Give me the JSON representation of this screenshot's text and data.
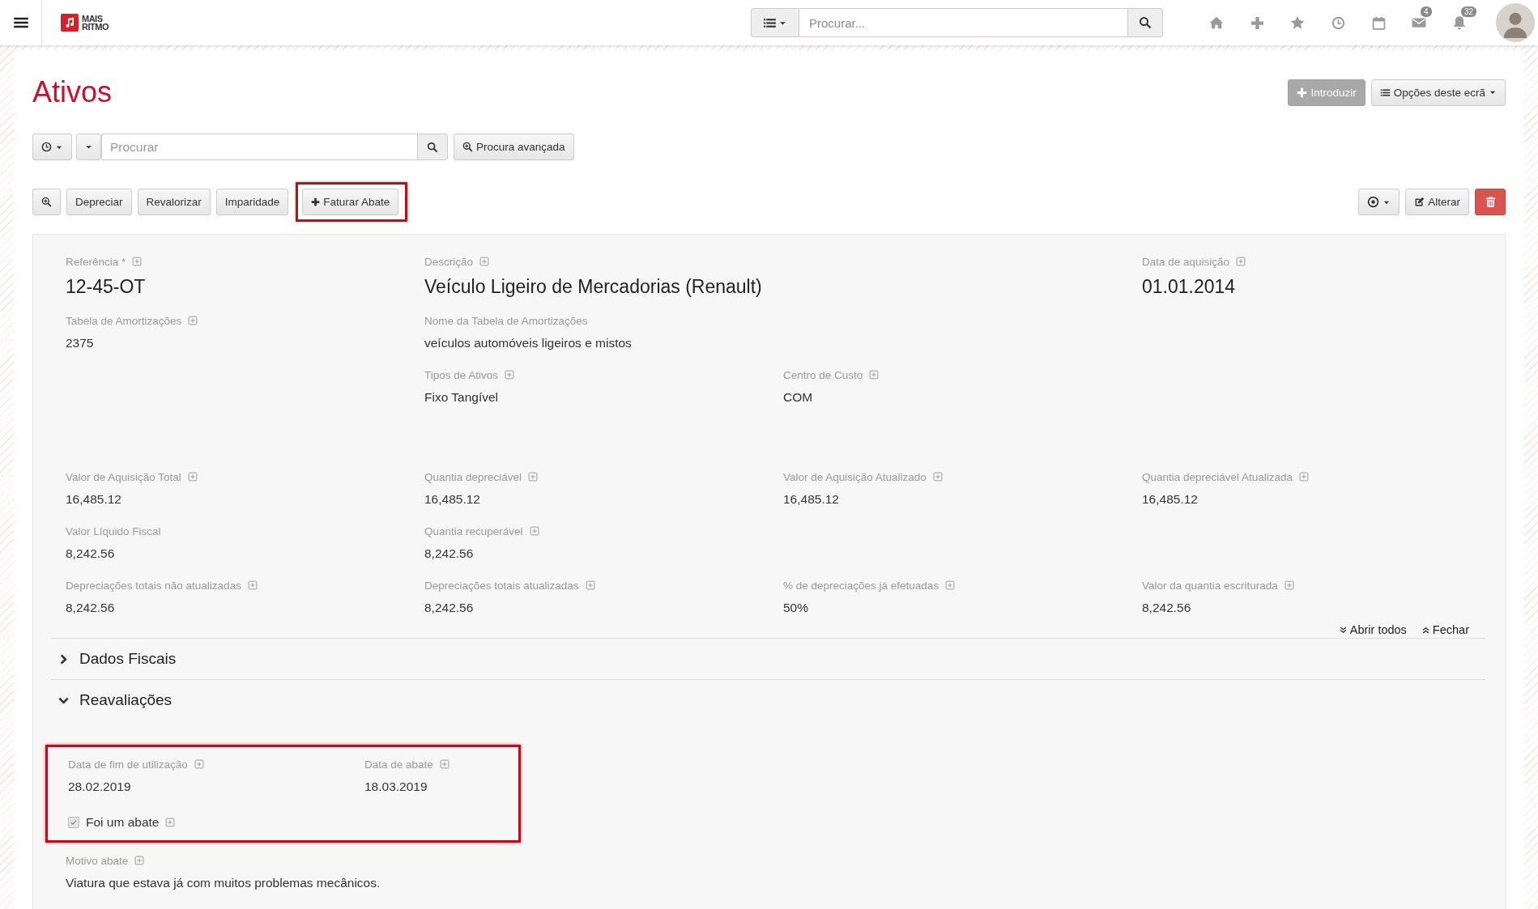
{
  "topbar": {
    "logo": [
      "MAIS",
      "RITMO"
    ],
    "search": {
      "placeholder": "Procurar..."
    },
    "message_count": "4",
    "notification_count": "32"
  },
  "title": "Ativos",
  "header_buttons": [
    {
      "label": "Introduzir",
      "kind": "primary"
    },
    {
      "label": "Opções deste ecrã",
      "kind": "menu"
    }
  ],
  "search": {
    "placeholder": "Procurar",
    "advanced": "Procura avançada"
  },
  "actions": [
    {
      "label": "Depreciar",
      "highlighted": false
    },
    {
      "label": "Revalorizar",
      "highlighted": false
    },
    {
      "label": "Imparidade",
      "highlighted": false
    },
    {
      "label": "Faturar Abate",
      "highlighted": true
    }
  ],
  "edit_button": "Alterar",
  "groups": [
    {
      "rows": [
        {
          "large": true,
          "cells": [
            {
              "label": "Referência *",
              "value": "12-45-OT",
              "info": true
            },
            {
              "label": "Descrição",
              "value": "Veículo Ligeiro de Mercadorias (Renault)",
              "info": true
            },
            null,
            {
              "label": "Data de aquisição",
              "value": "01.01.2014",
              "info": true
            }
          ]
        },
        {
          "large": false,
          "cells": [
            {
              "label": "Tabela de Amortizações",
              "value": "2375",
              "info": true
            },
            {
              "label": "Nome da Tabela de Amortizações",
              "value": "veículos automóveis ligeiros e mistos",
              "info": false
            }
          ]
        },
        {
          "large": false,
          "cells": [
            null,
            {
              "label": "Tipos de Ativos",
              "value": "Fixo Tangível",
              "info": true
            },
            {
              "label": "Centro de Custo",
              "value": "COM",
              "info": true
            }
          ]
        }
      ]
    },
    {
      "rows": [
        {
          "large": false,
          "cells": [
            {
              "label": "Valor de Aquisição Total",
              "value": "16,485.12",
              "info": true
            },
            {
              "label": "Quantia depreciável",
              "value": "16,485.12",
              "info": true
            },
            {
              "label": "Valor de Aquisição Atualizado",
              "value": "16,485.12",
              "info": true
            },
            {
              "label": "Quantia depreciável Atualizada",
              "value": "16,485.12",
              "info": true
            }
          ]
        },
        {
          "large": false,
          "cells": [
            {
              "label": "Valor Líquido Fiscal",
              "value": "8,242.56",
              "info": false
            },
            {
              "label": "Quantia recuperável",
              "value": "8,242.56",
              "info": true
            }
          ]
        },
        {
          "large": false,
          "cells": [
            {
              "label": "Depreciações totais não atualizadas",
              "value": "8,242.56",
              "info": true
            },
            {
              "label": "Depreciações totais atualizadas",
              "value": "8,242.56",
              "info": true
            },
            {
              "label": "% de depreciações já efetuadas",
              "value": "50%",
              "info": true
            },
            {
              "label": "Valor da quantia escriturada",
              "value": "8,242.56",
              "info": true
            }
          ]
        }
      ]
    }
  ],
  "links": {
    "open_all": "Abrir todos",
    "close": "Fechar"
  },
  "sections": [
    {
      "title": "Dados Fiscais",
      "expanded": false
    },
    {
      "title": "Reavaliações",
      "expanded": true,
      "highlighted": true,
      "fields": [
        {
          "label": "Data de fim de utilização",
          "value": "28.02.2019",
          "info": true
        },
        {
          "label": "Data de abate",
          "value": "18.03.2019",
          "info": true
        }
      ],
      "checkbox": {
        "label": "Foi um abate",
        "checked": true,
        "info": true
      },
      "notes": [
        {
          "label": "Motivo abate",
          "value": "Viatura que estava já com muitos problemas mecânicos.",
          "info": true
        }
      ]
    }
  ]
}
